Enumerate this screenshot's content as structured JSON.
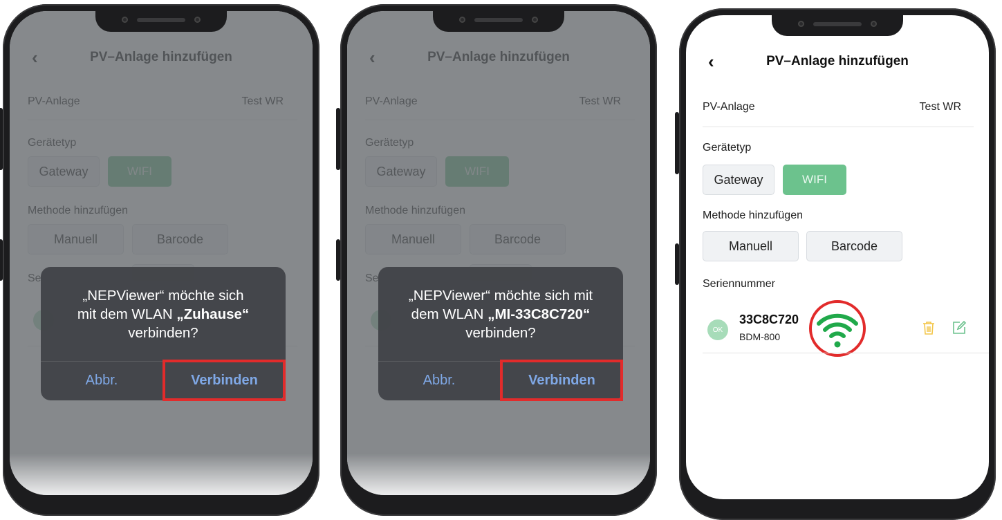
{
  "header": {
    "title": "PV–Anlage hinzufügen"
  },
  "pv_row": {
    "label": "PV-Anlage",
    "value": "Test WR"
  },
  "device_type": {
    "label": "Gerätetyp",
    "options": [
      "Gateway",
      "WIFI"
    ],
    "selected": "WIFI"
  },
  "add_method": {
    "label": "Methode hinzufügen",
    "options": [
      "Manuell",
      "Barcode"
    ]
  },
  "serial_section": {
    "label": "Seriennummer"
  },
  "device": {
    "status": "OK",
    "serial": "33C8C720",
    "model": "BDM-800"
  },
  "dialogs": [
    {
      "line1": "„NEPViewer“ möchte sich",
      "line2": "mit dem WLAN",
      "network": "„Zuhause“",
      "line3": "verbinden?",
      "cancel": "Abbr.",
      "confirm": "Verbinden"
    },
    {
      "line1": "„NEPViewer“ möchte sich mit",
      "line2": "dem WLAN",
      "network": "„MI-33C8C720“",
      "line3": "verbinden?",
      "cancel": "Abbr.",
      "confirm": "Verbinden"
    }
  ],
  "partial_label": "Se",
  "colors": {
    "accent_green": "#6cc28d",
    "highlight_red": "#e22b2b",
    "link_blue": "#7fa8e6",
    "trash_yellow": "#f3c64a",
    "edit_green": "#6cc28d"
  }
}
